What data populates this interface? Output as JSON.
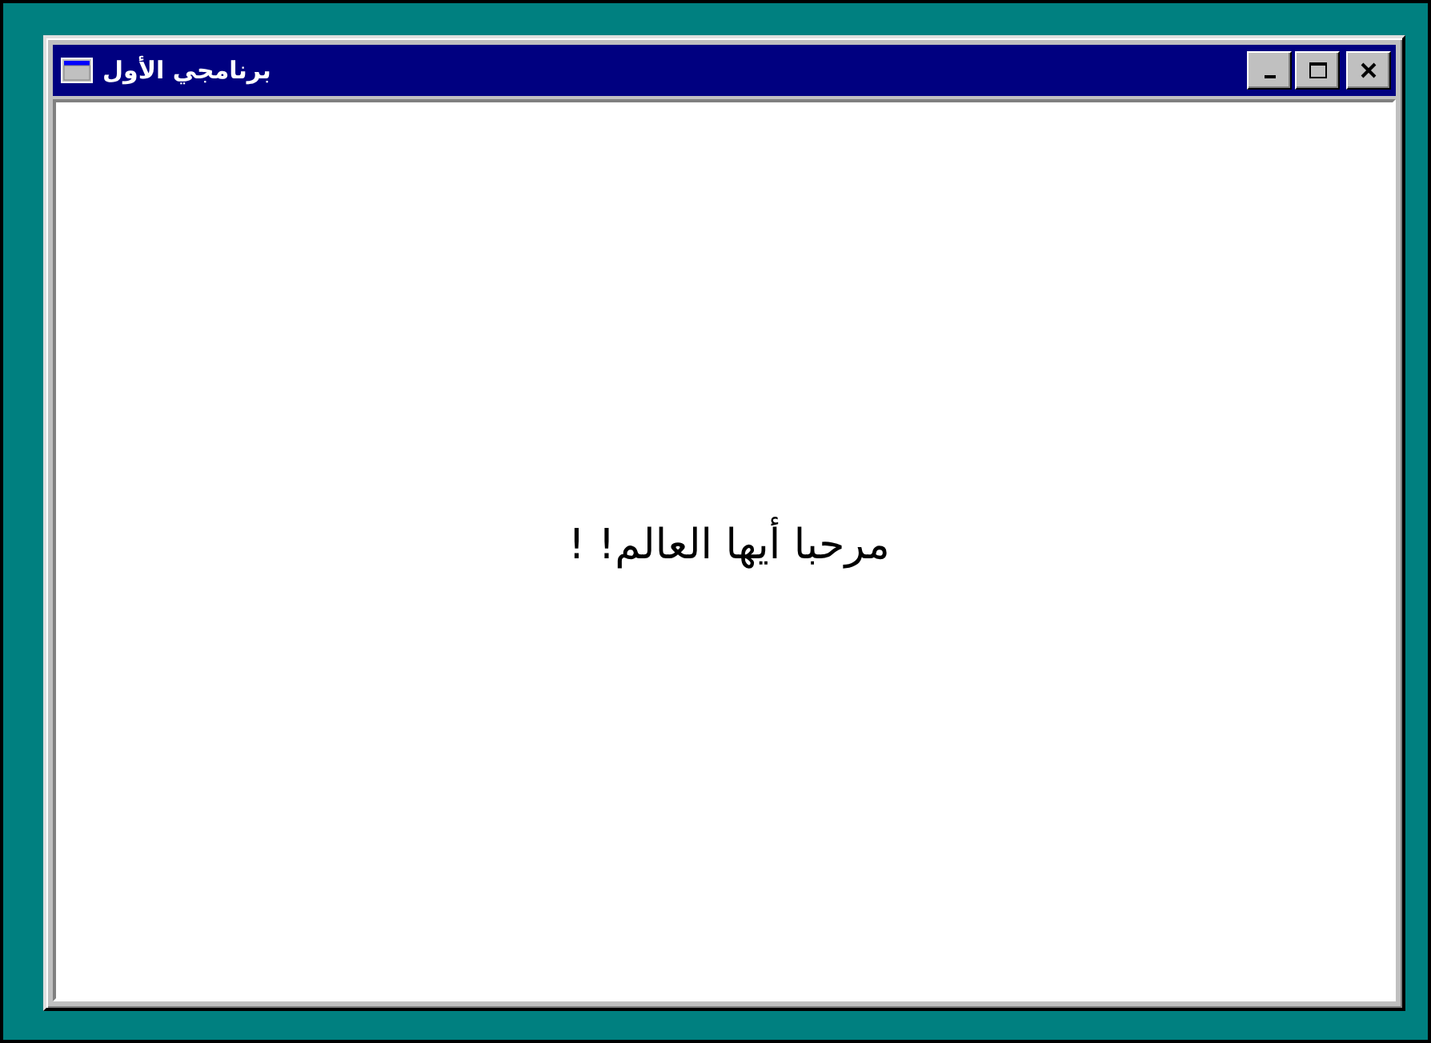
{
  "window": {
    "title": "برنامجي الأول",
    "buttons": [
      {
        "kind": "minimize"
      },
      {
        "kind": "maximize"
      },
      {
        "kind": "close"
      }
    ]
  },
  "content": {
    "message": "مرحبا أيها العالم! !"
  }
}
